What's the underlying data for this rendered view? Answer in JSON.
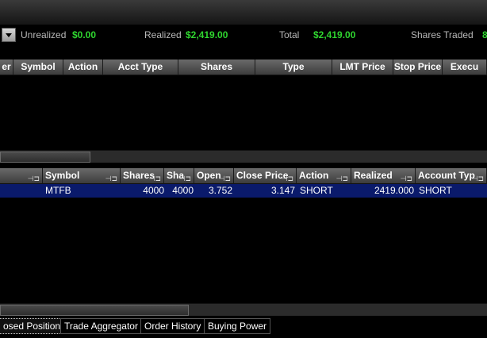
{
  "summary": {
    "unrealized_label": "Unrealized",
    "unrealized_value": "$0.00",
    "realized_label": "Realized",
    "realized_value": "$2,419.00",
    "total_label": "Total",
    "total_value": "$2,419.00",
    "shares_traded_label": "Shares Traded",
    "shares_traded_value": "8"
  },
  "orders_grid": {
    "columns": [
      "er",
      "Symbol",
      "Action",
      "Acct Type",
      "Shares",
      "Type",
      "LMT Price",
      "Stop Price",
      "Execu"
    ]
  },
  "positions_grid": {
    "columns": [
      "",
      "Symbol",
      "Shares",
      "Sha",
      "Open",
      "Close Price",
      "Action",
      "Realized",
      "Account Typ"
    ],
    "rows": [
      {
        "symbol": "MTFB",
        "shares": "4000",
        "sha": "4000",
        "open": "3.752",
        "close_price": "3.147",
        "action": "SHORT",
        "realized": "2419.000",
        "account_type": "SHORT"
      }
    ]
  },
  "tabs": [
    "osed Positions",
    "Trade Aggregator",
    "Order History",
    "Buying Power"
  ],
  "icons": {
    "dropdown": "chevron-down-icon",
    "pin": "pin-icon"
  },
  "colors": {
    "value_green": "#2fd52f",
    "selection": "#0a1a6b"
  }
}
